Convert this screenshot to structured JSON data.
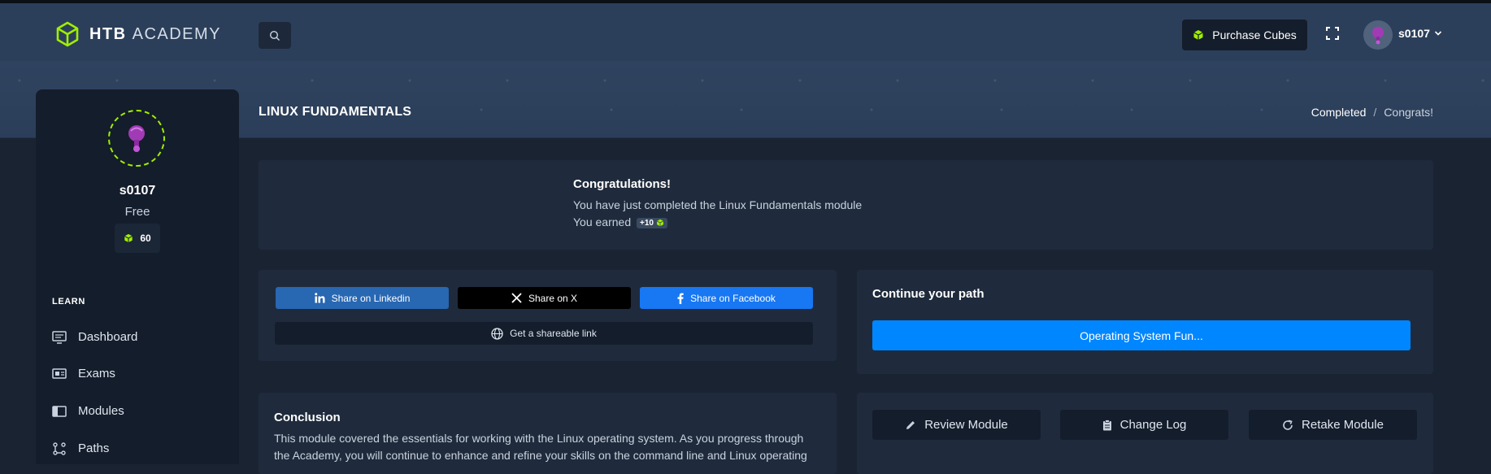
{
  "header": {
    "logo_bold": "HTB",
    "logo_light": "ACADEMY",
    "purchase_label": "Purchase Cubes",
    "username": "s0107"
  },
  "sidebar": {
    "username": "s0107",
    "plan": "Free",
    "cubes": "60",
    "section_label": "LEARN",
    "items": [
      {
        "label": "Dashboard",
        "icon": "monitor-icon"
      },
      {
        "label": "Exams",
        "icon": "exam-icon"
      },
      {
        "label": "Modules",
        "icon": "modules-icon"
      },
      {
        "label": "Paths",
        "icon": "paths-icon"
      }
    ]
  },
  "page": {
    "title": "LINUX FUNDAMENTALS",
    "breadcrumb": [
      "Completed",
      "/",
      "Congrats!"
    ]
  },
  "congrats": {
    "title": "Congratulations!",
    "line1": "You have just completed the Linux Fundamentals module",
    "earned_label": "You earned",
    "earned_badge": "+10"
  },
  "share": {
    "linkedin": "Share on Linkedin",
    "x": "Share on X",
    "facebook": "Share on Facebook",
    "link": "Get a shareable link"
  },
  "continue": {
    "title": "Continue your path",
    "path_button": "Operating System Fun..."
  },
  "conclusion": {
    "title": "Conclusion",
    "text": "This module covered the essentials for working with the Linux operating system. As you progress through the Academy, you will continue to enhance and refine your skills on the command line and Linux operating"
  },
  "actions": {
    "review": "Review Module",
    "changelog": "Change Log",
    "retake": "Retake Module"
  },
  "colors": {
    "accent_green": "#9fef00",
    "primary_blue": "#0086ff",
    "linkedin": "#2867b2",
    "facebook": "#1877f2",
    "x": "#000000"
  }
}
